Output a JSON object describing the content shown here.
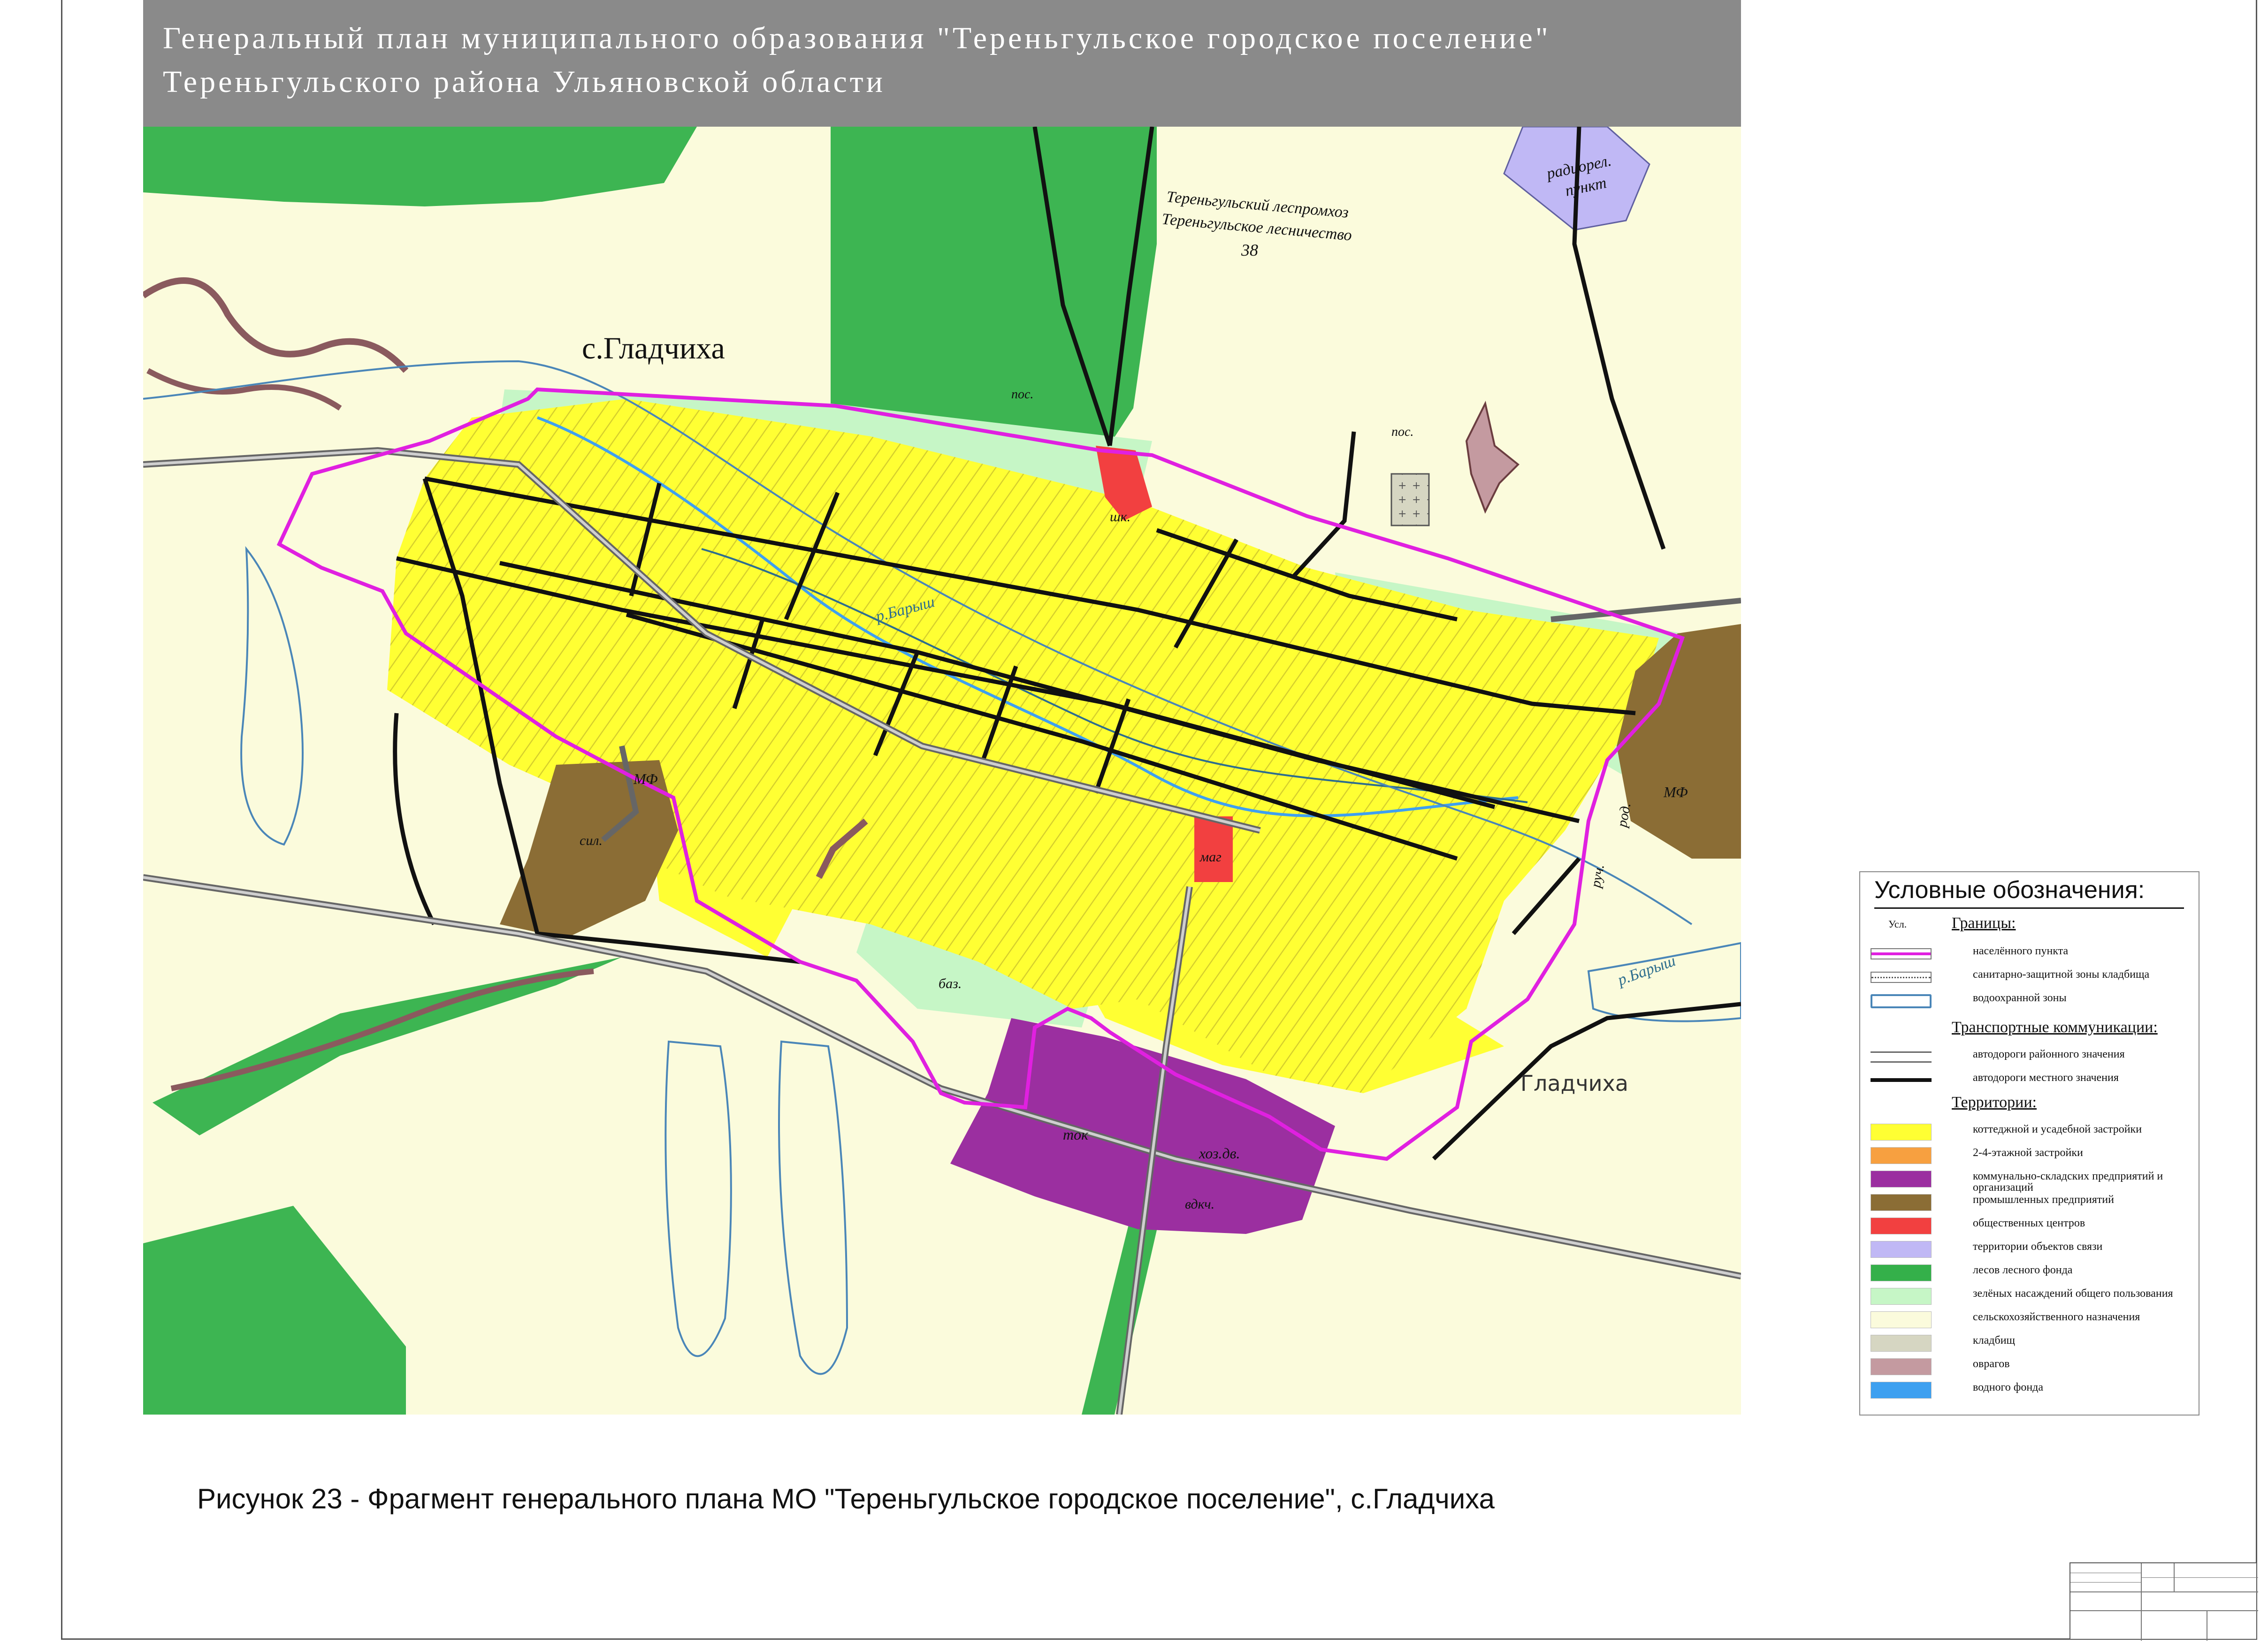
{
  "title": {
    "line1": "Генеральный план муниципального образования \"Тереньгульское городское поселение\"",
    "line2": "Тереньгульского района Ульяновской области"
  },
  "map": {
    "village_name": "с.Гладчиха",
    "map_village_label": "Гладчиха",
    "labels": {
      "forestry": "Тереньгульский леспромхоз",
      "forestry2": "Тереньгульское лесничество",
      "forest_number": "38",
      "radio": "радиорел.",
      "radio2": "пункт",
      "school": "шк.",
      "shop": "маг",
      "river": "р.Барыш",
      "river2": "р.Барыш",
      "mf": "МФ",
      "mf2": "МФ",
      "silo": "сил.",
      "tok": "ток",
      "farm": "хоз.дв.",
      "water_tower": "вдкч.",
      "base": "баз.",
      "spring": "род.",
      "stream": "руч.",
      "pos1": "пос.",
      "pos2": "пос."
    }
  },
  "legend": {
    "title": "Условные обозначения:",
    "symbol_header": "Усл.",
    "sections": {
      "borders": "Границы:",
      "transport": "Транспортные коммуникации:",
      "territories": "Территории:"
    },
    "borders": [
      {
        "label": "населённого пункта",
        "color": "#e020e0"
      },
      {
        "label": "санитарно-защитной зоны кладбища",
        "color": "#555555"
      },
      {
        "label": "водоохранной зоны",
        "color": "#4a86b8"
      }
    ],
    "transport": [
      {
        "label": "автодороги районного значения"
      },
      {
        "label": "автодороги местного значения"
      }
    ],
    "territories": [
      {
        "label": "коттеджной и усадебной застройки",
        "color": "#ffff33"
      },
      {
        "label": "2-4-этажной застройки",
        "color": "#f7a040"
      },
      {
        "label": "коммунально-складских предприятий и организаций",
        "color": "#9b2fa0"
      },
      {
        "label": "промышленных предприятий",
        "color": "#8b6d35"
      },
      {
        "label": "общественных центров",
        "color": "#f24040"
      },
      {
        "label": "территории объектов связи",
        "color": "#c0b8f5"
      },
      {
        "label": "лесов лесного фонда",
        "color": "#34b04a"
      },
      {
        "label": "зелёных насаждений общего пользования",
        "color": "#c6f6c6"
      },
      {
        "label": "сельскохозяйственного назначения",
        "color": "#fbfbdc"
      },
      {
        "label": "кладбищ",
        "color": "#d6d6c2"
      },
      {
        "label": "оврагов",
        "color": "#c49aa0"
      },
      {
        "label": "водного фонда",
        "color": "#3ea0f0"
      }
    ]
  },
  "caption": "Рисунок 23 - Фрагмент генерального плана МО \"Тереньгульское городское поселение\", с.Гладчиха"
}
